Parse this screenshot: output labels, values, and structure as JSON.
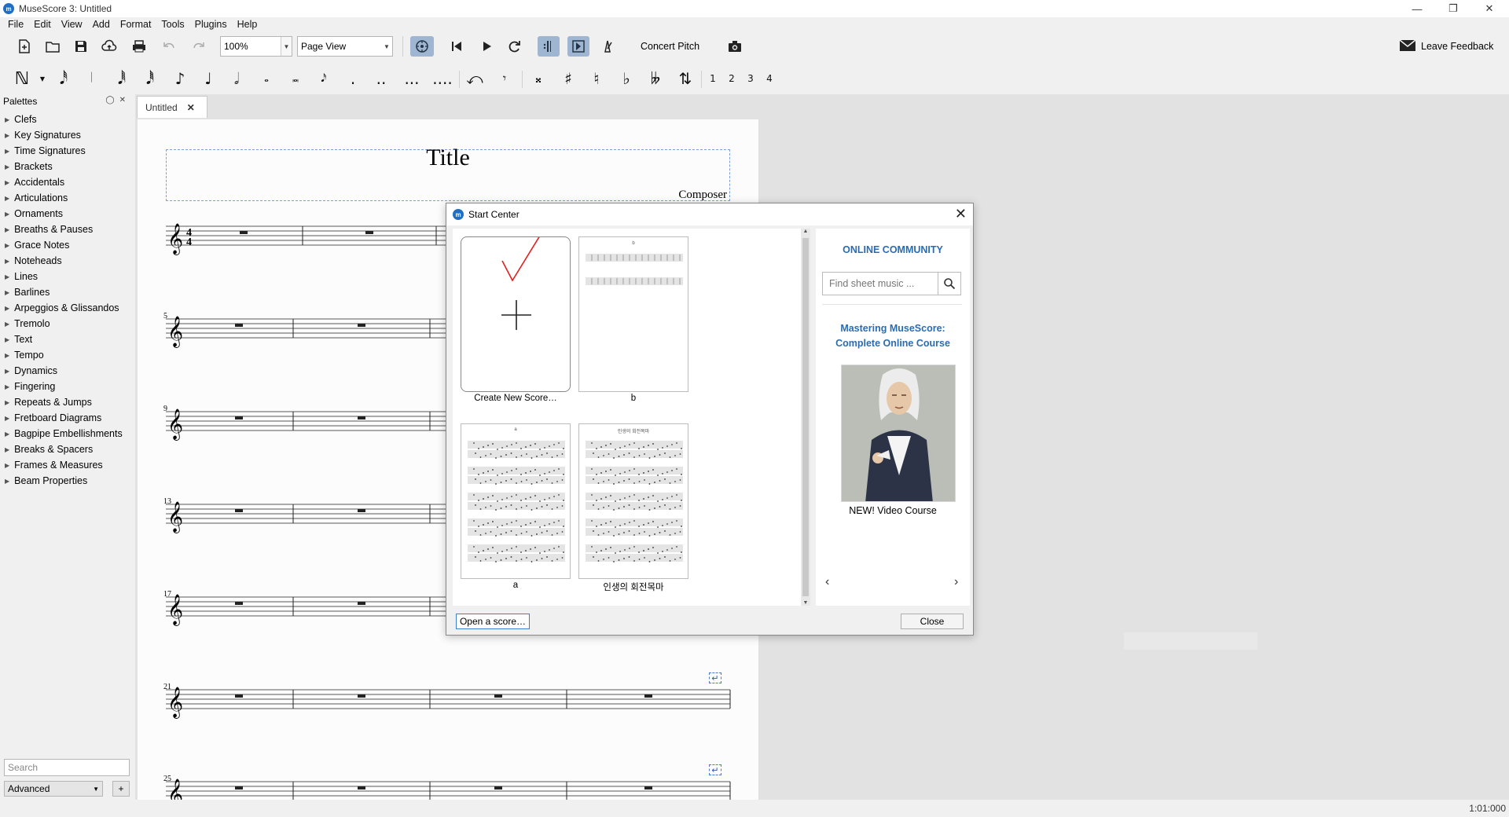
{
  "window": {
    "title": "MuseScore 3: Untitled",
    "app_icon": "musescore-logo",
    "controls": [
      "minimize",
      "restore",
      "close"
    ]
  },
  "menubar": [
    "File",
    "Edit",
    "View",
    "Add",
    "Format",
    "Tools",
    "Plugins",
    "Help"
  ],
  "toolbar": {
    "zoom_value": "100%",
    "view_mode": "Page View",
    "concert_pitch_label": "Concert Pitch",
    "leave_feedback_label": "Leave Feedback"
  },
  "note_toolbar": {
    "voices": [
      "1",
      "2",
      "3",
      "4"
    ]
  },
  "palettes": {
    "header": "Palettes",
    "items": [
      "Clefs",
      "Key Signatures",
      "Time Signatures",
      "Brackets",
      "Accidentals",
      "Articulations",
      "Ornaments",
      "Breaths & Pauses",
      "Grace Notes",
      "Noteheads",
      "Lines",
      "Barlines",
      "Arpeggios & Glissandos",
      "Tremolo",
      "Text",
      "Tempo",
      "Dynamics",
      "Fingering",
      "Repeats & Jumps",
      "Fretboard Diagrams",
      "Bagpipe Embellishments",
      "Breaks & Spacers",
      "Frames & Measures",
      "Beam Properties"
    ],
    "search_placeholder": "Search",
    "mode": "Advanced",
    "add_label": "+"
  },
  "score": {
    "tab_label": "Untitled",
    "tab_close": "✕",
    "title": "Title",
    "composer": "Composer",
    "time_signature": [
      "4",
      "4"
    ],
    "measure_numbers": [
      "5",
      "9",
      "13",
      "17",
      "21",
      "25"
    ]
  },
  "start_center": {
    "title": "Start Center",
    "close_x": "✕",
    "scores": [
      {
        "label": "Create New Score…",
        "type": "new"
      },
      {
        "label": "b",
        "type": "score",
        "thumb_title": "b"
      },
      {
        "label": "a",
        "type": "score",
        "thumb_title": "a"
      },
      {
        "label": "인생의 회전목마",
        "type": "score",
        "thumb_title": "인생의 회전목마"
      }
    ],
    "community": {
      "heading": "ONLINE COMMUNITY",
      "search_placeholder": "Find sheet music ...",
      "course_title_line1": "Mastering MuseScore:",
      "course_title_line2": "Complete Online Course",
      "caption": "NEW! Video Course",
      "prev": "‹",
      "next": "›"
    },
    "open_button": "Open a score…",
    "close_button": "Close"
  },
  "status": {
    "time": "1:01:000"
  },
  "colors": {
    "accent": "#2b6cb0",
    "selected_tool": "#9fb6d2",
    "annotation_check": "#e0201c"
  }
}
